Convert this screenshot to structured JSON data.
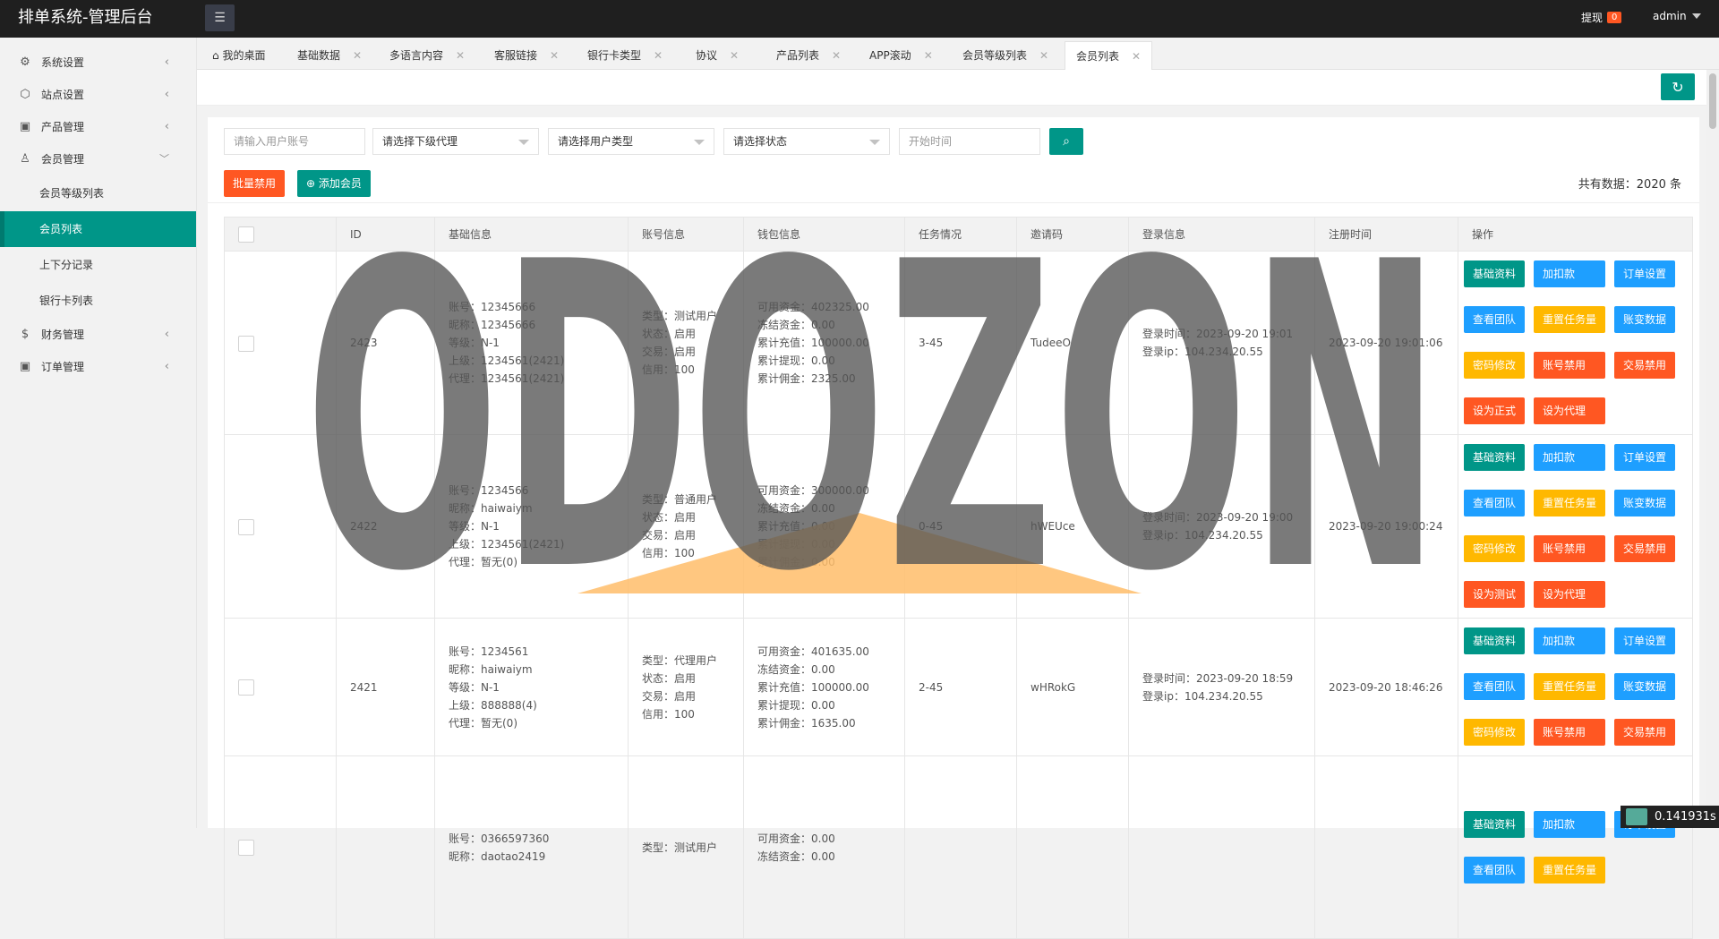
{
  "header": {
    "brand": "排单系统-管理后台",
    "withdraw_label": "提现",
    "withdraw_badge": "0",
    "user": "admin"
  },
  "sidebar": {
    "items": [
      {
        "label": "系统设置",
        "icon": "gear-icon"
      },
      {
        "label": "站点设置",
        "icon": "site-icon"
      },
      {
        "label": "产品管理",
        "icon": "box-icon"
      },
      {
        "label": "会员管理",
        "icon": "user-icon"
      },
      {
        "label": "财务管理",
        "icon": "dollar-icon"
      },
      {
        "label": "订单管理",
        "icon": "order-icon"
      }
    ],
    "member_sub": [
      "会员等级列表",
      "会员列表",
      "上下分记录",
      "银行卡列表"
    ]
  },
  "tabs": [
    {
      "label": "我的桌面"
    },
    {
      "label": "基础数据"
    },
    {
      "label": "多语言内容"
    },
    {
      "label": "客服链接"
    },
    {
      "label": "银行卡类型"
    },
    {
      "label": "协议"
    },
    {
      "label": "产品列表"
    },
    {
      "label": "APP滚动"
    },
    {
      "label": "会员等级列表"
    },
    {
      "label": "会员列表"
    }
  ],
  "filters": {
    "account_placeholder": "请输入用户账号",
    "agent_select": "请选择下级代理",
    "type_select": "请选择用户类型",
    "status_select": "请选择状态",
    "start_time_placeholder": "开始时间"
  },
  "actions": {
    "batch_disable": "批量禁用",
    "add_member": "添加会员",
    "total": "共有数据：2020 条"
  },
  "table": {
    "headers": [
      "ID",
      "基础信息",
      "账号信息",
      "钱包信息",
      "任务情况",
      "邀请码",
      "登录信息",
      "注册时间",
      "操作"
    ],
    "rows": [
      {
        "id": "2423",
        "base": [
          "账号：12345666",
          "昵称：12345666",
          "等级：N-1",
          "上级：1234561(2421)",
          "代理：1234561(2421)"
        ],
        "account": [
          "类型：测试用户",
          "状态：启用",
          "交易：启用",
          "信用：100"
        ],
        "wallet": [
          "可用资金：402325.00",
          "冻结资金：0.00",
          "累计充值：100000.00",
          "累计提现：0.00",
          "累计佣金：2325.00"
        ],
        "task": "3-45",
        "invite": "TudeeO",
        "login": [
          "登录时间：2023-09-20 19:01",
          "登录ip：104.234.20.55"
        ],
        "reg": "2023-09-20 19:01:06",
        "ops": [
          {
            "label": "基础资料",
            "color": "green"
          },
          {
            "label": "加扣款",
            "color": "blue"
          },
          {
            "label": "订单设置",
            "color": "blue"
          },
          {
            "label": "查看团队",
            "color": "blue"
          },
          {
            "label": "重置任务量",
            "color": "orange"
          },
          {
            "label": "账变数据",
            "color": "blue"
          },
          {
            "label": "密码修改",
            "color": "orange"
          },
          {
            "label": "账号禁用",
            "color": "red"
          },
          {
            "label": "交易禁用",
            "color": "red"
          },
          {
            "label": "设为正式",
            "color": "red"
          },
          {
            "label": "设为代理",
            "color": "red"
          }
        ]
      },
      {
        "id": "2422",
        "base": [
          "账号：1234566",
          "昵称：haiwaiym",
          "等级：N-1",
          "上级：1234561(2421)",
          "代理：暂无(0)"
        ],
        "account": [
          "类型：普通用户",
          "状态：启用",
          "交易：启用",
          "信用：100"
        ],
        "wallet": [
          "可用资金：300000.00",
          "冻结资金：0.00",
          "累计充值：0.00",
          "累计提现：0.00",
          "累计佣金：0.00"
        ],
        "task": "0-45",
        "invite": "hWEUce",
        "login": [
          "登录时间：2023-09-20 19:00",
          "登录ip：104.234.20.55"
        ],
        "reg": "2023-09-20 19:00:24",
        "ops": [
          {
            "label": "基础资料",
            "color": "green"
          },
          {
            "label": "加扣款",
            "color": "blue"
          },
          {
            "label": "订单设置",
            "color": "blue"
          },
          {
            "label": "查看团队",
            "color": "blue"
          },
          {
            "label": "重置任务量",
            "color": "orange"
          },
          {
            "label": "账变数据",
            "color": "blue"
          },
          {
            "label": "密码修改",
            "color": "orange"
          },
          {
            "label": "账号禁用",
            "color": "red"
          },
          {
            "label": "交易禁用",
            "color": "red"
          },
          {
            "label": "设为测试",
            "color": "red"
          },
          {
            "label": "设为代理",
            "color": "red"
          }
        ]
      },
      {
        "id": "2421",
        "base": [
          "账号：1234561",
          "昵称：haiwaiym",
          "等级：N-1",
          "上级：888888(4)",
          "代理：暂无(0)"
        ],
        "account": [
          "类型：代理用户",
          "状态：启用",
          "交易：启用",
          "信用：100"
        ],
        "wallet": [
          "可用资金：401635.00",
          "冻结资金：0.00",
          "累计充值：100000.00",
          "累计提现：0.00",
          "累计佣金：1635.00"
        ],
        "task": "2-45",
        "invite": "wHRokG",
        "login": [
          "登录时间：2023-09-20 18:59",
          "登录ip：104.234.20.55"
        ],
        "reg": "2023-09-20 18:46:26",
        "ops": [
          {
            "label": "基础资料",
            "color": "green"
          },
          {
            "label": "加扣款",
            "color": "blue"
          },
          {
            "label": "订单设置",
            "color": "blue"
          },
          {
            "label": "查看团队",
            "color": "blue"
          },
          {
            "label": "重置任务量",
            "color": "orange"
          },
          {
            "label": "账变数据",
            "color": "blue"
          },
          {
            "label": "密码修改",
            "color": "orange"
          },
          {
            "label": "账号禁用",
            "color": "red"
          },
          {
            "label": "交易禁用",
            "color": "red"
          }
        ]
      },
      {
        "id": "",
        "base": [
          "账号：0366597360",
          "昵称：daotao2419"
        ],
        "account": [
          "类型：测试用户"
        ],
        "wallet": [
          "可用资金：0.00",
          "冻结资金：0.00"
        ],
        "task": "",
        "invite": "",
        "login": [],
        "reg": "",
        "ops": [
          {
            "label": "基础资料",
            "color": "green"
          },
          {
            "label": "加扣款",
            "color": "blue"
          },
          {
            "label": "订单设置",
            "color": "blue"
          },
          {
            "label": "查看团队",
            "color": "blue"
          },
          {
            "label": "重置任务量",
            "color": "orange"
          }
        ]
      }
    ]
  },
  "watermark": "ODOZON",
  "timer": "0.141931s"
}
